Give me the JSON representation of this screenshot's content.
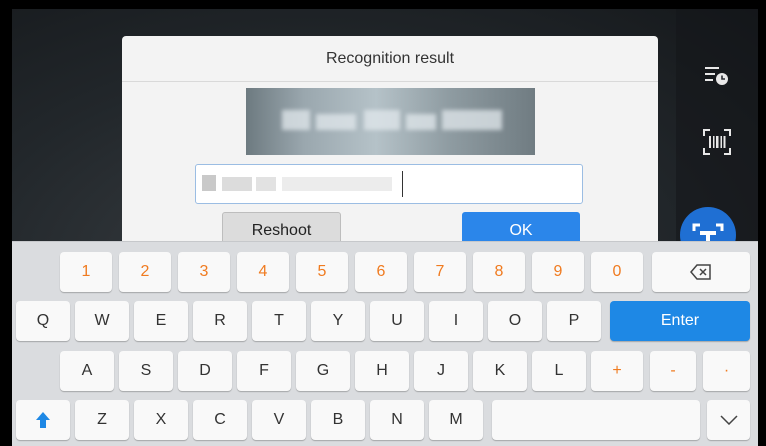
{
  "dialog": {
    "title": "Recognition result",
    "reshoot_label": "Reshoot",
    "ok_label": "OK"
  },
  "keyboard": {
    "row1": [
      "1",
      "2",
      "3",
      "4",
      "5",
      "6",
      "7",
      "8",
      "9",
      "0"
    ],
    "row2": [
      "Q",
      "W",
      "E",
      "R",
      "T",
      "Y",
      "U",
      "I",
      "O",
      "P"
    ],
    "enter_label": "Enter",
    "row3": [
      "A",
      "S",
      "D",
      "F",
      "G",
      "H",
      "J",
      "K",
      "L"
    ],
    "row3_symbols": [
      "+",
      "-",
      "·"
    ],
    "row4": [
      "Z",
      "X",
      "C",
      "V",
      "B",
      "N",
      "M"
    ]
  },
  "colors": {
    "accent_blue": "#2b86ea",
    "digit_orange": "#f07b20"
  },
  "icons": [
    "history-icon",
    "barcode-scan-icon",
    "text-recognition-icon",
    "backspace-icon",
    "shift-icon",
    "chevron-down-icon"
  ]
}
